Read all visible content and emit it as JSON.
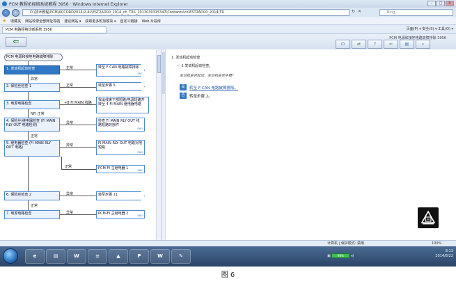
{
  "window": {
    "title": "PCM 教程IE经络系统教程  3956 · Windows Internet Explorer",
    "controls": [
      "–",
      "□",
      "X"
    ]
  },
  "address": {
    "url": "D:\\技术教程\\PCM\\ACCORD2014\\2.4L\\EST2AD00_2014_ch_TRS_2013030315347\\Contents\\ch\\EST2AD00_2014\\TR",
    "search_placeholder": "Bing"
  },
  "favorites": {
    "label": "收藏夹",
    "items": [
      "网站收录全部网址导航",
      "建议网站 ▾",
      "获取更多附加模块 ▾",
      "自定义链接",
      "Web 片段库"
    ]
  },
  "tab": {
    "label": "PCM 电路经络诊断系统  3956"
  },
  "cmdbar": {
    "text": "页面(P) ▾   安全(S) ▾   工具(O) ▾"
  },
  "toolband": {
    "back_symbol": "⇐",
    "pcm_title": "PCM 电源和接地电路故障排除  3956",
    "tools": [
      "⊡",
      "⇄",
      "?",
      "⇐",
      "▤",
      "⌕"
    ]
  },
  "flow": {
    "start": "PCM 电源和接地电路故障排除",
    "nodes": [
      {
        "text": "1. 发动机起动检查",
        "style": "dark"
      },
      {
        "text": "转至 F-CAN 电路故障排除",
        "style": "arrow",
        "eng": "ENG"
      },
      {
        "text": "2. 保险丝检查 1",
        "style": "light"
      },
      {
        "text": "转至步骤 5",
        "style": "arrow"
      },
      {
        "text": "3. 电源电路检查",
        "style": "light"
      },
      {
        "text": "找出线束下部短路/电源短路并转至 4 FI MAIN 继电器电路",
        "style": "plain"
      },
      {
        "text": "4. 保险丝/继电器检查 (FI MAIN RLY OUT 电路检测)",
        "style": "light"
      },
      {
        "text": "检查 FI MAIN RLY OUT 线路短路的部件",
        "style": "plain",
        "eng": "ENG"
      },
      {
        "text": "5. 继电器检查 (FI MAIN RLY OUT 电路)",
        "style": "light"
      },
      {
        "text": "FI MAIN RLY OUT 电路对地短路",
        "style": "plain",
        "eng": "ENG"
      },
      {
        "text": "PCM-FI 主继电器 1",
        "style": "plain",
        "eng": "ENG"
      },
      {
        "text": "6. 保险丝检查 2",
        "style": "light"
      },
      {
        "text": "转至步骤 11",
        "style": "arrow"
      },
      {
        "text": "7. 电源电路检查",
        "style": "light"
      },
      {
        "text": "PCM-FI 主继电器 2",
        "style": "plain",
        "eng": "ENG"
      }
    ],
    "labels": [
      "正常",
      "异常",
      "正常",
      "+B FI MAIN 线路",
      "NFI 正常",
      "异常",
      "正常",
      "异常",
      "正常",
      "异常",
      "正常",
      "异常"
    ]
  },
  "info": {
    "heading": "1. 发动机起动检查",
    "sub": "一 1 发动机起动检查。",
    "question": "发动机是否起动，发动机是否平稳?",
    "choices": [
      {
        "icon": "是",
        "text": "转至 F-CAN 电路故障排除。",
        "link": true
      },
      {
        "icon": "否",
        "text": "转至步骤 2。",
        "link": false
      }
    ]
  },
  "status": {
    "zone": "计算机 | 保护模式: 禁用",
    "zoom": "100%"
  },
  "taskbar": {
    "buttons": [
      "e",
      "▤",
      "W",
      "≡",
      "▲",
      "P",
      "W",
      "✎"
    ],
    "battery": "98%",
    "time": "8:13",
    "date": "2014/8/22"
  },
  "caption": "图 6"
}
